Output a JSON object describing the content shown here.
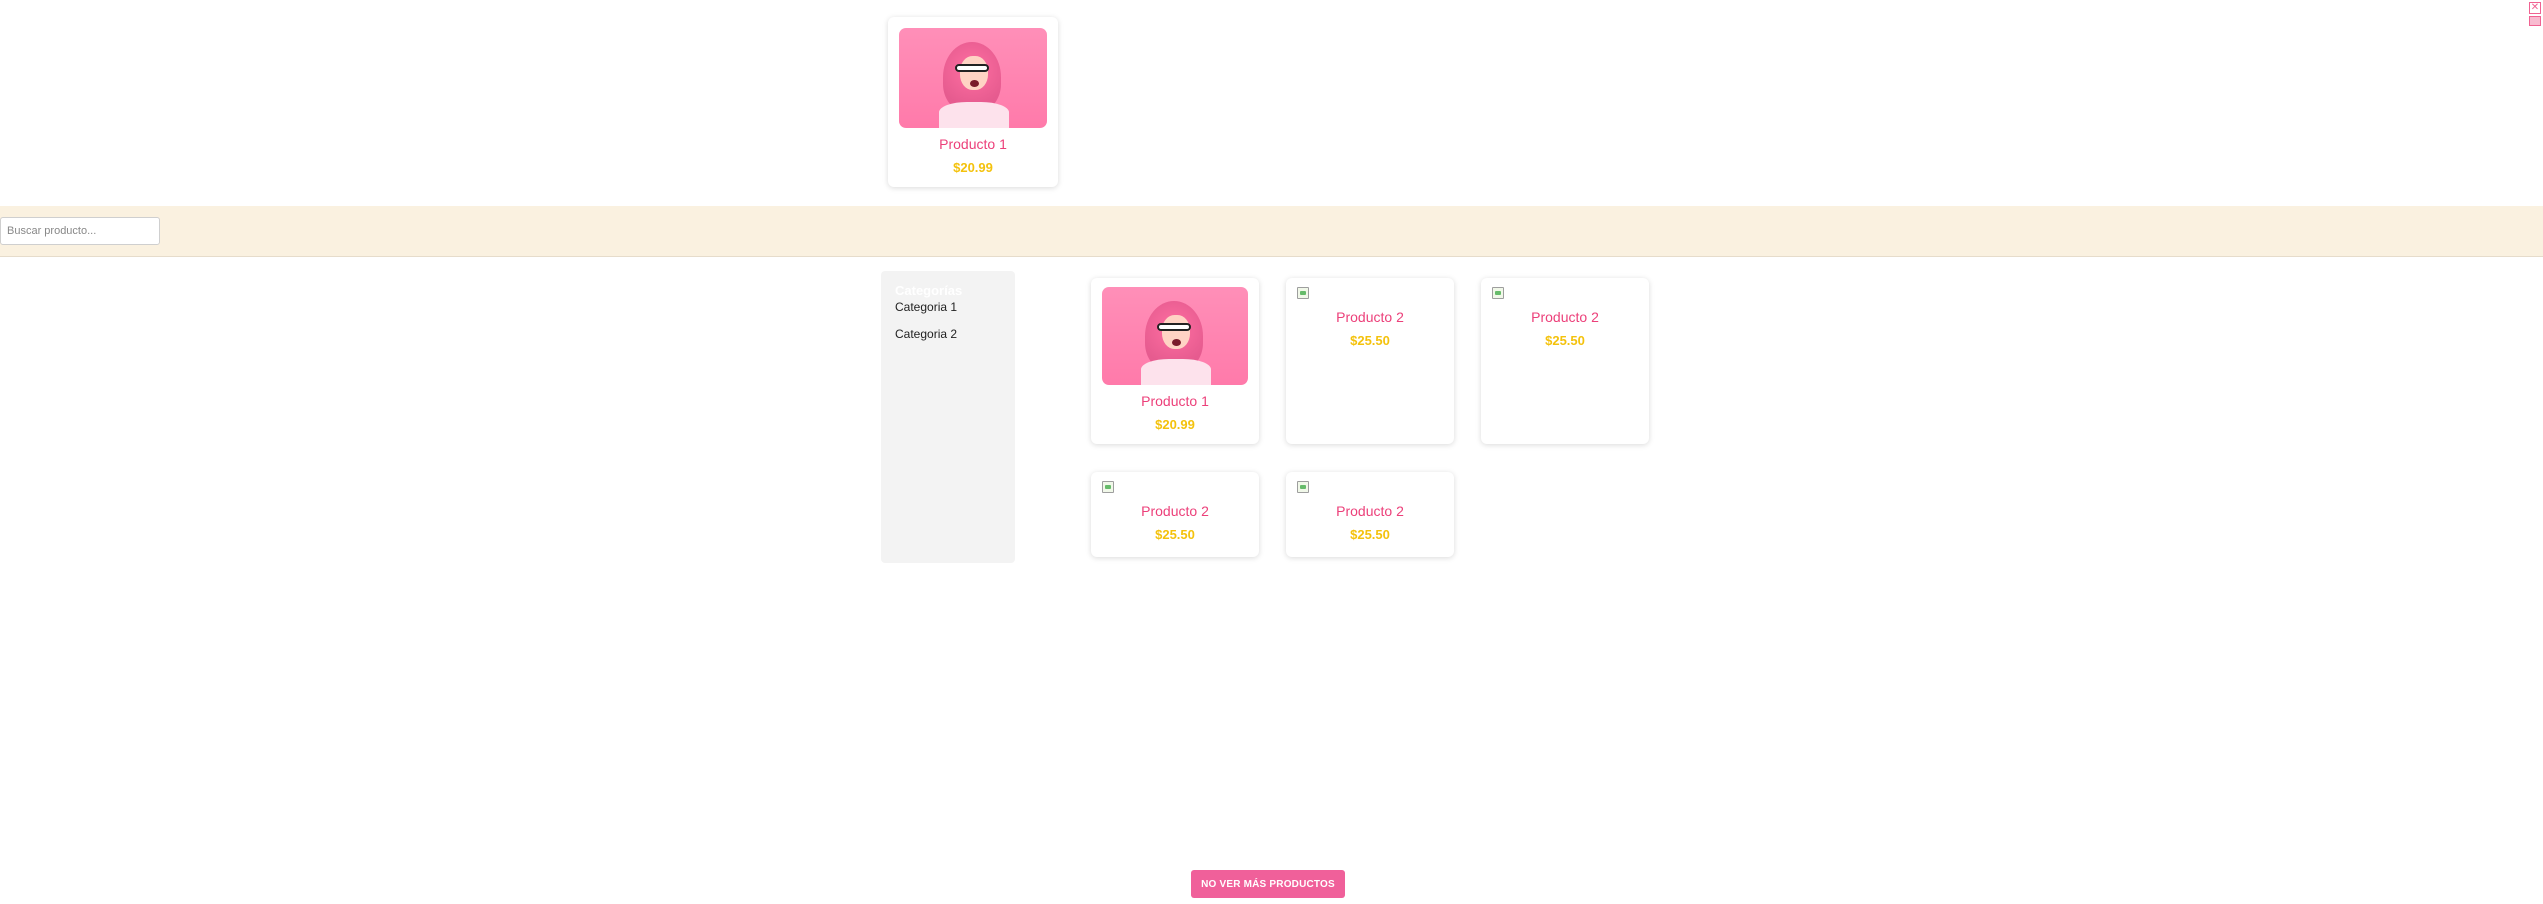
{
  "featured": {
    "name": "Producto 1",
    "price": "$20.99"
  },
  "search": {
    "placeholder": "Buscar producto...",
    "value": ""
  },
  "sidebar": {
    "title": "Categorías",
    "items": [
      {
        "label": "Categoria 1"
      },
      {
        "label": "Categoria 2"
      }
    ]
  },
  "products": [
    {
      "name": "Producto 1",
      "price": "$20.99",
      "has_image": true
    },
    {
      "name": "Producto 2",
      "price": "$25.50",
      "has_image": false
    },
    {
      "name": "Producto 2",
      "price": "$25.50",
      "has_image": false
    },
    {
      "name": "Producto 2",
      "price": "$25.50",
      "has_image": false
    },
    {
      "name": "Producto 2",
      "price": "$25.50",
      "has_image": false
    }
  ],
  "load_more_label": "NO VER MÁS PRODUCTOS",
  "corner_close_glyph": "✕",
  "colors": {
    "accent_pink": "#ec407a",
    "price_yellow": "#f4c20d",
    "search_band": "#faf1e0",
    "button_pink": "#f0609a"
  }
}
